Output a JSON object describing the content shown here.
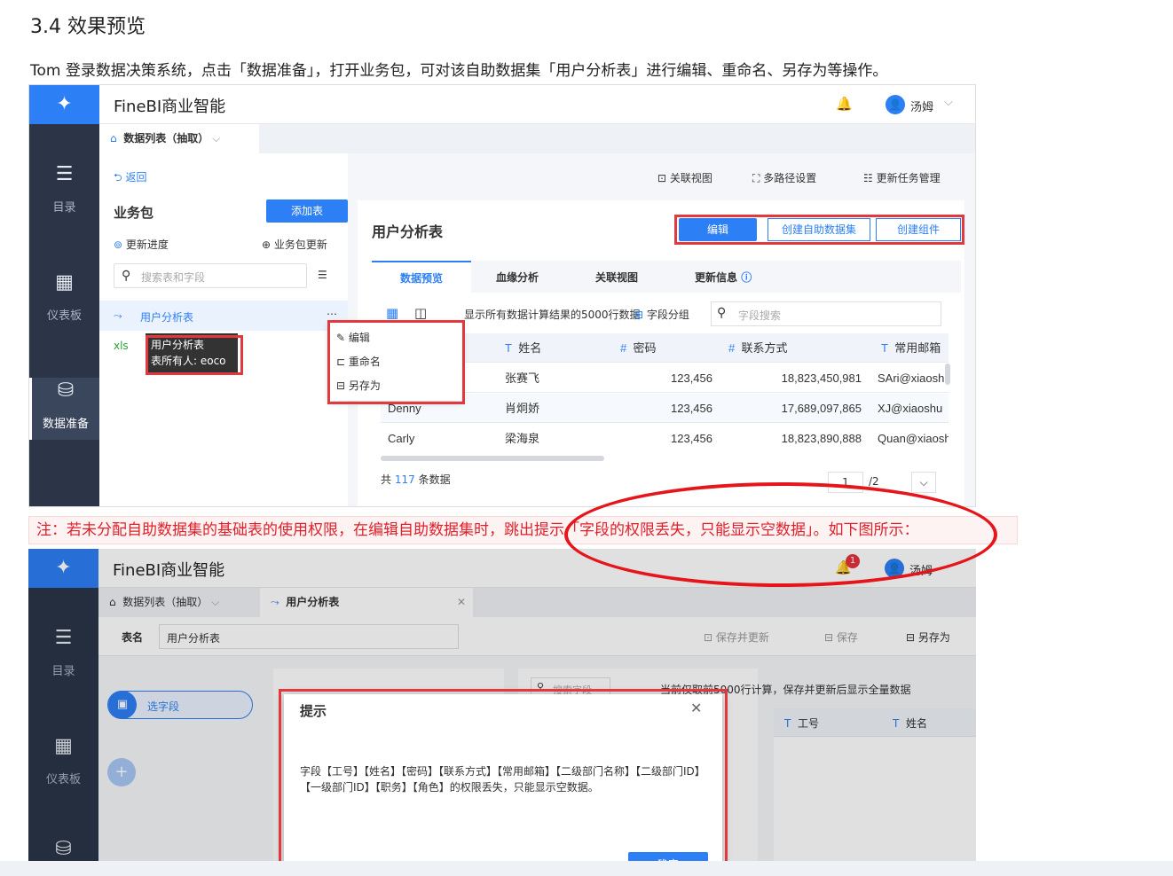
{
  "heading": "3.4 效果预览",
  "intro": "Tom 登录数据决策系统，点击「数据准备」，打开业务包，可对该自助数据集「用户分析表」进行编辑、重命名、另存为等操作。",
  "note": "注：若未分配自助数据集的基础表的使用权限，在编辑自助数据集时，跳出提示「字段的权限丢失，只能显示空数据」。如下图所示：",
  "app": {
    "brand": "FineBI商业智能",
    "user": "汤姆",
    "notif_count": "1"
  },
  "sidebar": {
    "items": [
      {
        "label": "目录",
        "icon": "list-icon"
      },
      {
        "label": "仪表板",
        "icon": "dashboard-icon"
      },
      {
        "label": "数据准备",
        "icon": "database-icon"
      }
    ]
  },
  "shot1": {
    "tab_label": "数据列表（抽取）",
    "back": "返回",
    "toolbar": {
      "relation": "关联视图",
      "multipath": "多路径设置",
      "update_task": "更新任务管理"
    },
    "pack_title": "业务包",
    "add_table": "添加表",
    "update_progress": "更新进度",
    "pack_update": "业务包更新",
    "search_placeholder": "搜索表和字段",
    "table_item": "用户分析表",
    "xls_tag": "xls",
    "tooltip_line1": "用户分析表",
    "tooltip_line2": "表所有人: eoco",
    "menu": [
      "编辑",
      "重命名",
      "另存为"
    ],
    "detail_title": "用户分析表",
    "actions": {
      "edit": "编辑",
      "create_dataset": "创建自助数据集",
      "create_component": "创建组件"
    },
    "detail_tabs": [
      "数据预览",
      "血缘分析",
      "关联视图",
      "更新信息"
    ],
    "preview_hint": "显示所有数据计算结果的5000行数据",
    "group_label": "字段分组",
    "field_search": "字段搜索",
    "columns": [
      "姓名",
      "密码",
      "联系方式",
      "常用邮箱"
    ],
    "rows": [
      [
        "",
        "张赛飞",
        "123,456",
        "18,823,450,981",
        "SAri@xiaoshu"
      ],
      [
        "Denny",
        "肖炯娇",
        "123,456",
        "17,689,097,865",
        "XJ@xiaoshu"
      ],
      [
        "Carly",
        "梁海泉",
        "123,456",
        "18,823,890,888",
        "Quan@xiaoshu"
      ]
    ],
    "total_prefix": "共",
    "total_count": "117",
    "total_suffix": "条数据",
    "page_current": "1",
    "page_total": "/2"
  },
  "shot2": {
    "tab_list": "数据列表（抽取）",
    "tab_table": "用户分析表",
    "name_label": "表名",
    "name_value": "用户分析表",
    "save_update": "保存并更新",
    "save": "保存",
    "save_as": "另存为",
    "select_field": "选字段",
    "search_field": "搜索字段",
    "hint_text": "当前仅取前5000行计算，保存并更新后显示全量数据",
    "col1": "工号",
    "col2": "姓名",
    "dialog_title": "提示",
    "dialog_body": "字段【工号】【姓名】【密码】【联系方式】【常用邮箱】【二级部门名称】【二级部门ID】【一级部门ID】【职务】【角色】的权限丢失，只能显示空数据。",
    "dialog_btn": "确定"
  }
}
